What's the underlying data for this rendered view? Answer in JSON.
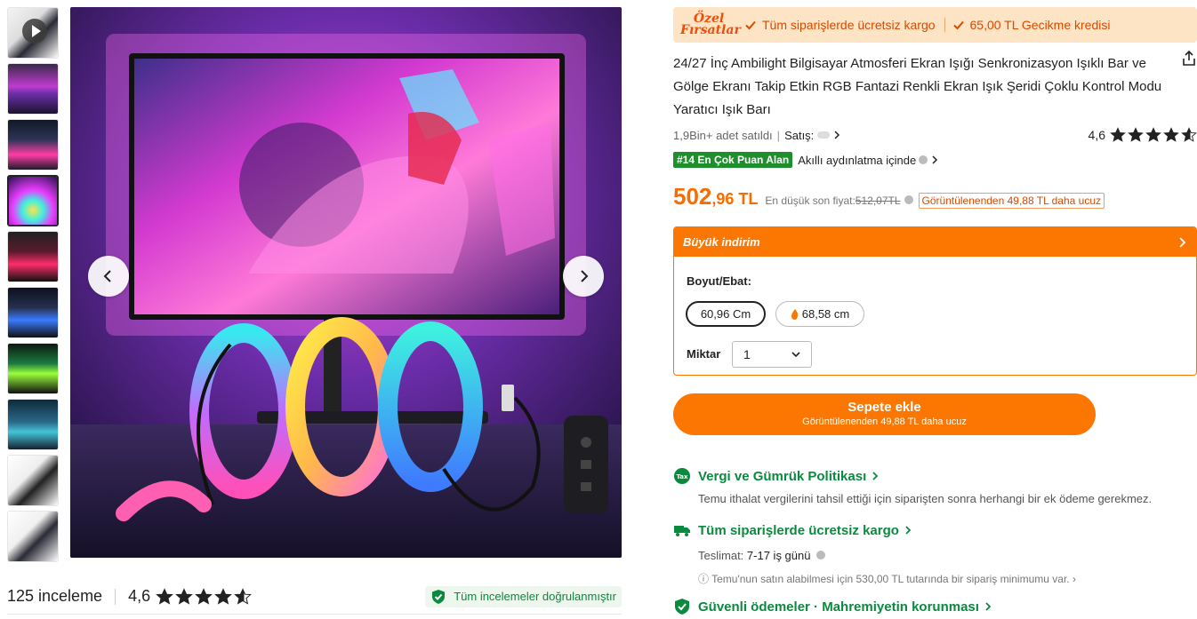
{
  "gallery": {
    "thumbs": 10,
    "selected_index": 3
  },
  "reviews": {
    "count_label": "125 inceleme",
    "rating": "4,6",
    "stars": 4.6,
    "verified_label": "Tüm incelemeler doğrulanmıştır"
  },
  "promo": {
    "logo_line1": "Özel",
    "logo_line2": "Fırsatlar",
    "chip1": "Tüm siparişlerde ücretsiz kargo",
    "chip2": "65,00 TL Gecikme kredisi"
  },
  "product": {
    "title": "24/27 İnç Ambilight Bilgisayar Atmosferi Ekran Işığı Senkronizasyon Işıklı Bar ve Gölge Ekranı Takip Etkin RGB Fantazi Renkli Ekran Işık Şeridi Çoklu Kontrol Modu Yaratıcı Işık Barı",
    "sold": "1,9Bin+ adet satıldı",
    "seller_label": "Satış:",
    "rating": "4,6",
    "stars": 4.6,
    "rank_badge": "#14 En Çok Puan Alan",
    "rank_category": "Akıllı aydınlatma içinde"
  },
  "price": {
    "main": "502",
    "decimal": ",96 TL",
    "lowest_label": "En düşük son fiyat:",
    "lowest_value": "512,07TL",
    "cheaper": "Görüntülenenden 49,88 TL daha ucuz"
  },
  "deal": {
    "title": "Büyük indirim",
    "size_label": "Boyut/Ebat:",
    "options": [
      "60,96 Cm",
      "68,58 cm"
    ],
    "qty_label": "Miktar",
    "qty_value": "1"
  },
  "cart": {
    "label": "Sepete ekle",
    "sub": "Görüntülenenden 49,88 TL daha ucuz"
  },
  "tax": {
    "icon_text": "Tax",
    "title": "Vergi ve Gümrük Politikası",
    "desc": "Temu ithalat vergilerini tahsil ettiği için siparişten sonra herhangi bir ek ödeme gerekmez."
  },
  "shipping": {
    "title": "Tüm siparişlerde ücretsiz kargo",
    "delivery_label": "Teslimat:",
    "delivery_value": "7-17 iş günü",
    "min_note": "Temu'nun satın alabilmesi için 530,00 TL tutarında bir sipariş minimumu var."
  },
  "security": {
    "title": "Güvenli ödemeler · Mahremiyetin korunması"
  },
  "colors": {
    "accent": "#fb7701",
    "green": "#0a8a3e"
  }
}
